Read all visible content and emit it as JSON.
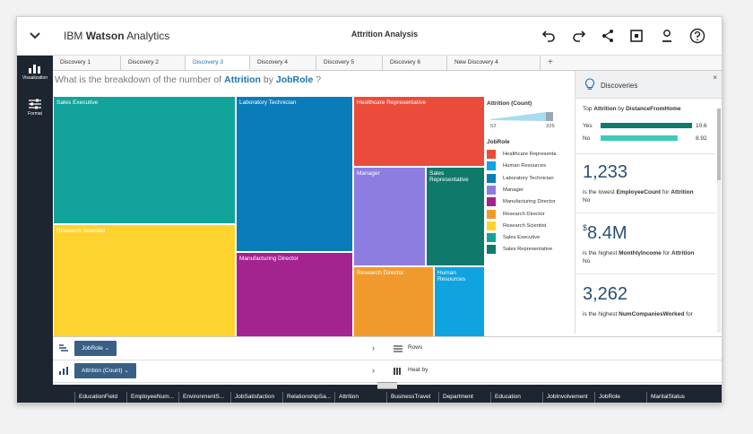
{
  "topbar": {
    "brand_prefix": "IBM",
    "brand_name": "Watson",
    "brand_suffix": "Analytics",
    "title": "Attrition Analysis"
  },
  "rail": {
    "items": [
      {
        "label": "Visualization",
        "icon": "bar-chart-icon"
      },
      {
        "label": "Format",
        "icon": "sliders-icon"
      }
    ]
  },
  "tabs": [
    {
      "label": "Discovery 1"
    },
    {
      "label": "Discovery 2"
    },
    {
      "label": "Discovery 3"
    },
    {
      "label": "Discovery 4"
    },
    {
      "label": "Discovery 5"
    },
    {
      "label": "Discovery 6"
    },
    {
      "label": "New Discovery 4"
    }
  ],
  "active_tab": 2,
  "question": {
    "prefix": "What is the breakdown of the number of",
    "measure": "Attrition",
    "joiner": "by",
    "dimension": "JobRole",
    "suffix": "?"
  },
  "treemap": {
    "tiles": [
      {
        "label": "Sales Executive",
        "color": "#12a39a"
      },
      {
        "label": "Research Scientist",
        "color": "#fed330"
      },
      {
        "label": "Laboratory Technician",
        "color": "#0b7cba"
      },
      {
        "label": "Manufacturing Director",
        "color": "#a3238f"
      },
      {
        "label": "Healthcare Representative",
        "color": "#eb4b3a"
      },
      {
        "label": "Manager",
        "color": "#8e7de0"
      },
      {
        "label": "Sales Representative",
        "color": "#0f7a6c"
      },
      {
        "label": "Research Director",
        "color": "#f09a2e"
      },
      {
        "label": "Human Resources",
        "color": "#0fa3e0"
      }
    ]
  },
  "legend": {
    "size_title": "Attrition (Count)",
    "size_min": "52",
    "size_max": "326",
    "color_title": "JobRole",
    "items": [
      {
        "label": "Healthcare Representa",
        "color": "#eb4b3a"
      },
      {
        "label": "Human Resources",
        "color": "#0fa3e0"
      },
      {
        "label": "Laboratory Technician",
        "color": "#0b7cba"
      },
      {
        "label": "Manager",
        "color": "#8e7de0"
      },
      {
        "label": "Manufacturing Director",
        "color": "#a3238f"
      },
      {
        "label": "Research Director",
        "color": "#f09a2e"
      },
      {
        "label": "Research Scientist",
        "color": "#fed330"
      },
      {
        "label": "Sales Executive",
        "color": "#12a39a"
      },
      {
        "label": "Sales Representative",
        "color": "#0f7a6c"
      }
    ]
  },
  "discoveries": {
    "title": "Discoveries",
    "close": "×",
    "top_prefix": "Top",
    "top_measure": "Attrition",
    "top_joiner": "by",
    "top_dimension": "DistanceFromHome",
    "bars": [
      {
        "label": "Yes",
        "value": 10.6,
        "display": "10.6",
        "color": "#0f7a6c"
      },
      {
        "label": "No",
        "value": 8.92,
        "display": "8.92",
        "color": "#3ecab8"
      }
    ],
    "insights": [
      {
        "value": "1,233",
        "prefix": "is the lowest",
        "field": "EmployeeCount",
        "mid": "for",
        "target": "Attrition",
        "tail": "No"
      },
      {
        "value": "8.4M",
        "currency": "$",
        "prefix": "is the highest",
        "field": "MonthlyIncome",
        "mid": "for",
        "target": "Attrition",
        "tail": "No"
      },
      {
        "value": "3,262",
        "prefix": "is the highest",
        "field": "NumCompaniesWorked",
        "mid": "for",
        "target": "",
        "tail": ""
      }
    ]
  },
  "shelves": {
    "rows": [
      {
        "pill": "JobRole",
        "target": "Rows"
      },
      {
        "pill": "Attrition (Count)",
        "target": "Heat by"
      }
    ]
  },
  "fields": [
    "EducationField",
    "EmployeeNum...",
    "EnvironmentS...",
    "JobSatisfaction",
    "RelationshipSa...",
    "Attrition",
    "BusinessTravel",
    "Department",
    "Education",
    "JobInvolvement",
    "JobRole",
    "MaritalStatus"
  ]
}
